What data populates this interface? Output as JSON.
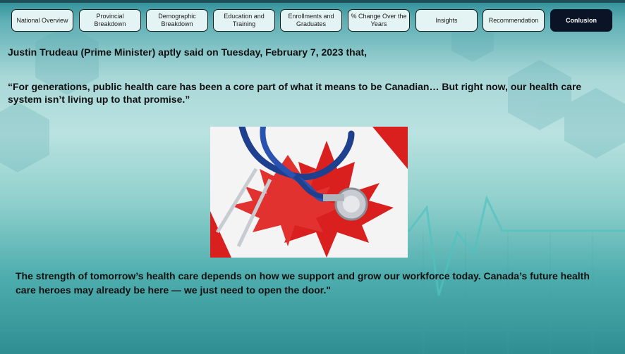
{
  "tabs": [
    {
      "label": "National Overview",
      "active": false
    },
    {
      "label": "Provincial Breakdown",
      "active": false
    },
    {
      "label": "Demographic Breakdown",
      "active": false
    },
    {
      "label": "Education and Training",
      "active": false
    },
    {
      "label": "Enrollments and Graduates",
      "active": false
    },
    {
      "label": "% Change Over the Years",
      "active": false
    },
    {
      "label": "Insights",
      "active": false
    },
    {
      "label": "Recommendation",
      "active": false
    },
    {
      "label": "Conlusion",
      "active": true
    }
  ],
  "intro": {
    "name": "Justin Trudeau",
    "rest": " (Prime Minister) aptly said on Tuesday, February 7, 2023 that,"
  },
  "quote": "“For generations, public health care has been a core part of what it means to be Canadian… But right now, our health care system isn’t living up to that promise.”",
  "closing": "The strength of tomorrow’s health care depends on how we support and grow our workforce today. Canada’s future health care heroes may already be here — we just need to open the door.\"",
  "image": {
    "icon": "stethoscope-on-canadian-flag",
    "colors": {
      "flag_red": "#d9201f",
      "tube_blue": "#1f3f8f",
      "metal": "#c8ccd2"
    }
  },
  "colors": {
    "active_tab": "#0b1426",
    "tab_bg": "#e4f3f4",
    "text": "#111111"
  }
}
